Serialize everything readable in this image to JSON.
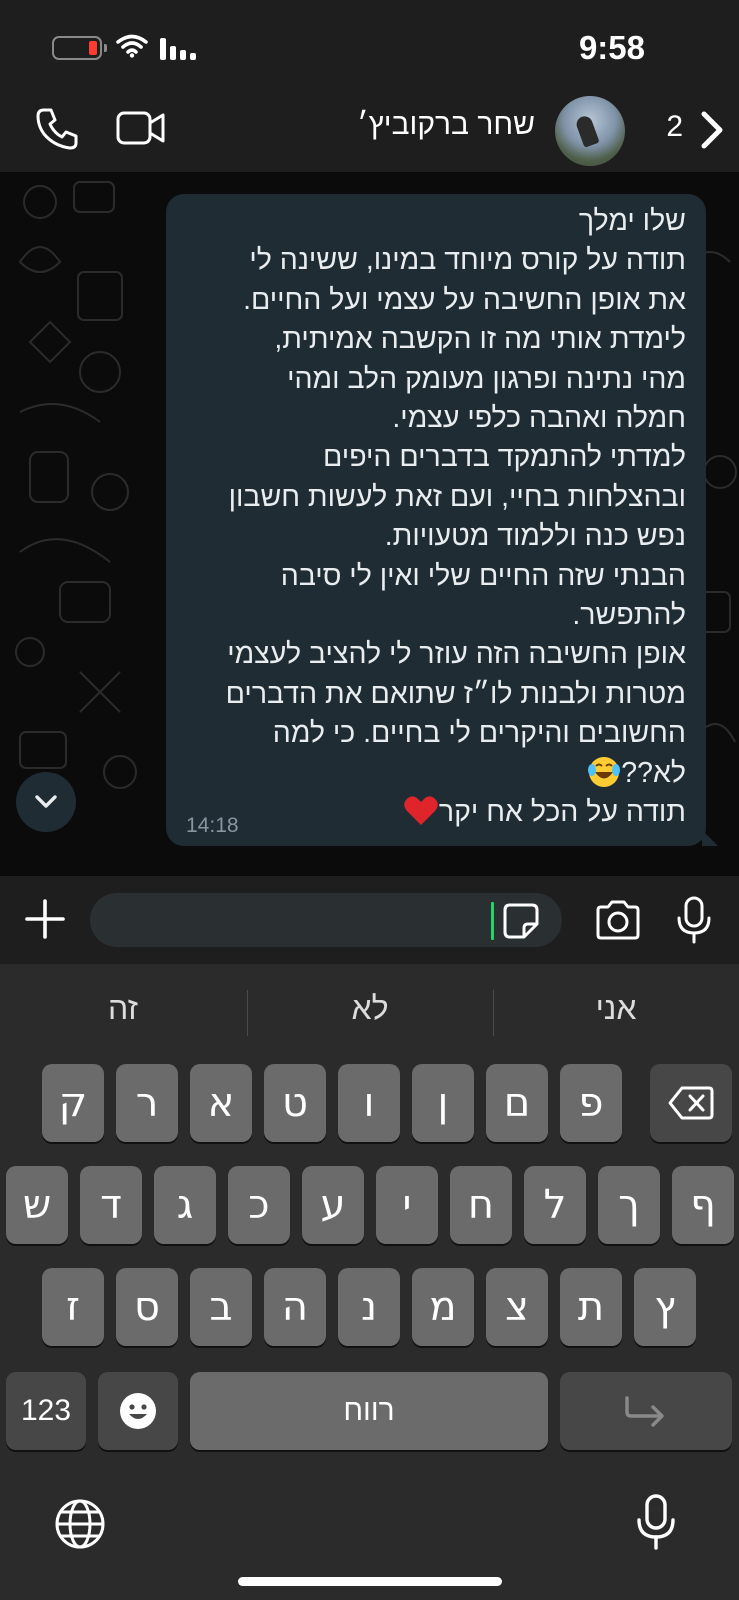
{
  "status_bar": {
    "time": "9:58",
    "battery_color": "#ff3b30"
  },
  "header": {
    "contact_name": "שחר ברקוביץ׳",
    "unread_count": "2",
    "icons": [
      "phone-icon",
      "video-camera-icon",
      "avatar",
      "chevron-right-icon"
    ]
  },
  "message": {
    "lines": [
      "שלו ימלך",
      "תודה על קורס מיוחד במינו, ששינה לי",
      "את אופן החשיבה על עצמי ועל החיים.",
      "לימדת אותי מה זו הקשבה אמיתית,",
      "מהי נתינה ופרגון מעומק הלב ומהי",
      "חמלה ואהבה כלפי עצמי.",
      "למדתי להתמקד בדברים היפים",
      "ובהצלחות בחיי, ועם זאת לעשות חשבון",
      "נפש כנה וללמוד מטעויות.",
      "הבנתי שזה החיים שלי ואין לי סיבה",
      "להתפשר.",
      "אופן החשיבה הזה עוזר לי להציב לעצמי",
      "מטרות ולבנות לו״ז שתואם את הדברים",
      "החשובים והיקרים לי בחיים. כי למה",
      "לא??",
      "תודה על הכל אח יקר"
    ],
    "time": "14:18",
    "bubble_color": "#1f2c34"
  },
  "input_bar": {
    "value": "",
    "placeholder": "",
    "accent_color": "#25d366"
  },
  "keyboard": {
    "predictions": [
      "אני",
      "לא",
      "זה"
    ],
    "row1": [
      "ק",
      "ר",
      "א",
      "ט",
      "ו",
      "ן",
      "ם",
      "פ"
    ],
    "row2": [
      "ש",
      "ד",
      "ג",
      "כ",
      "ע",
      "י",
      "ח",
      "ל",
      "ך",
      "ף"
    ],
    "row3": [
      "ז",
      "ס",
      "ב",
      "ה",
      "נ",
      "מ",
      "צ",
      "ת",
      "ץ"
    ],
    "numbers_label": "123",
    "space_label": "רווח"
  }
}
